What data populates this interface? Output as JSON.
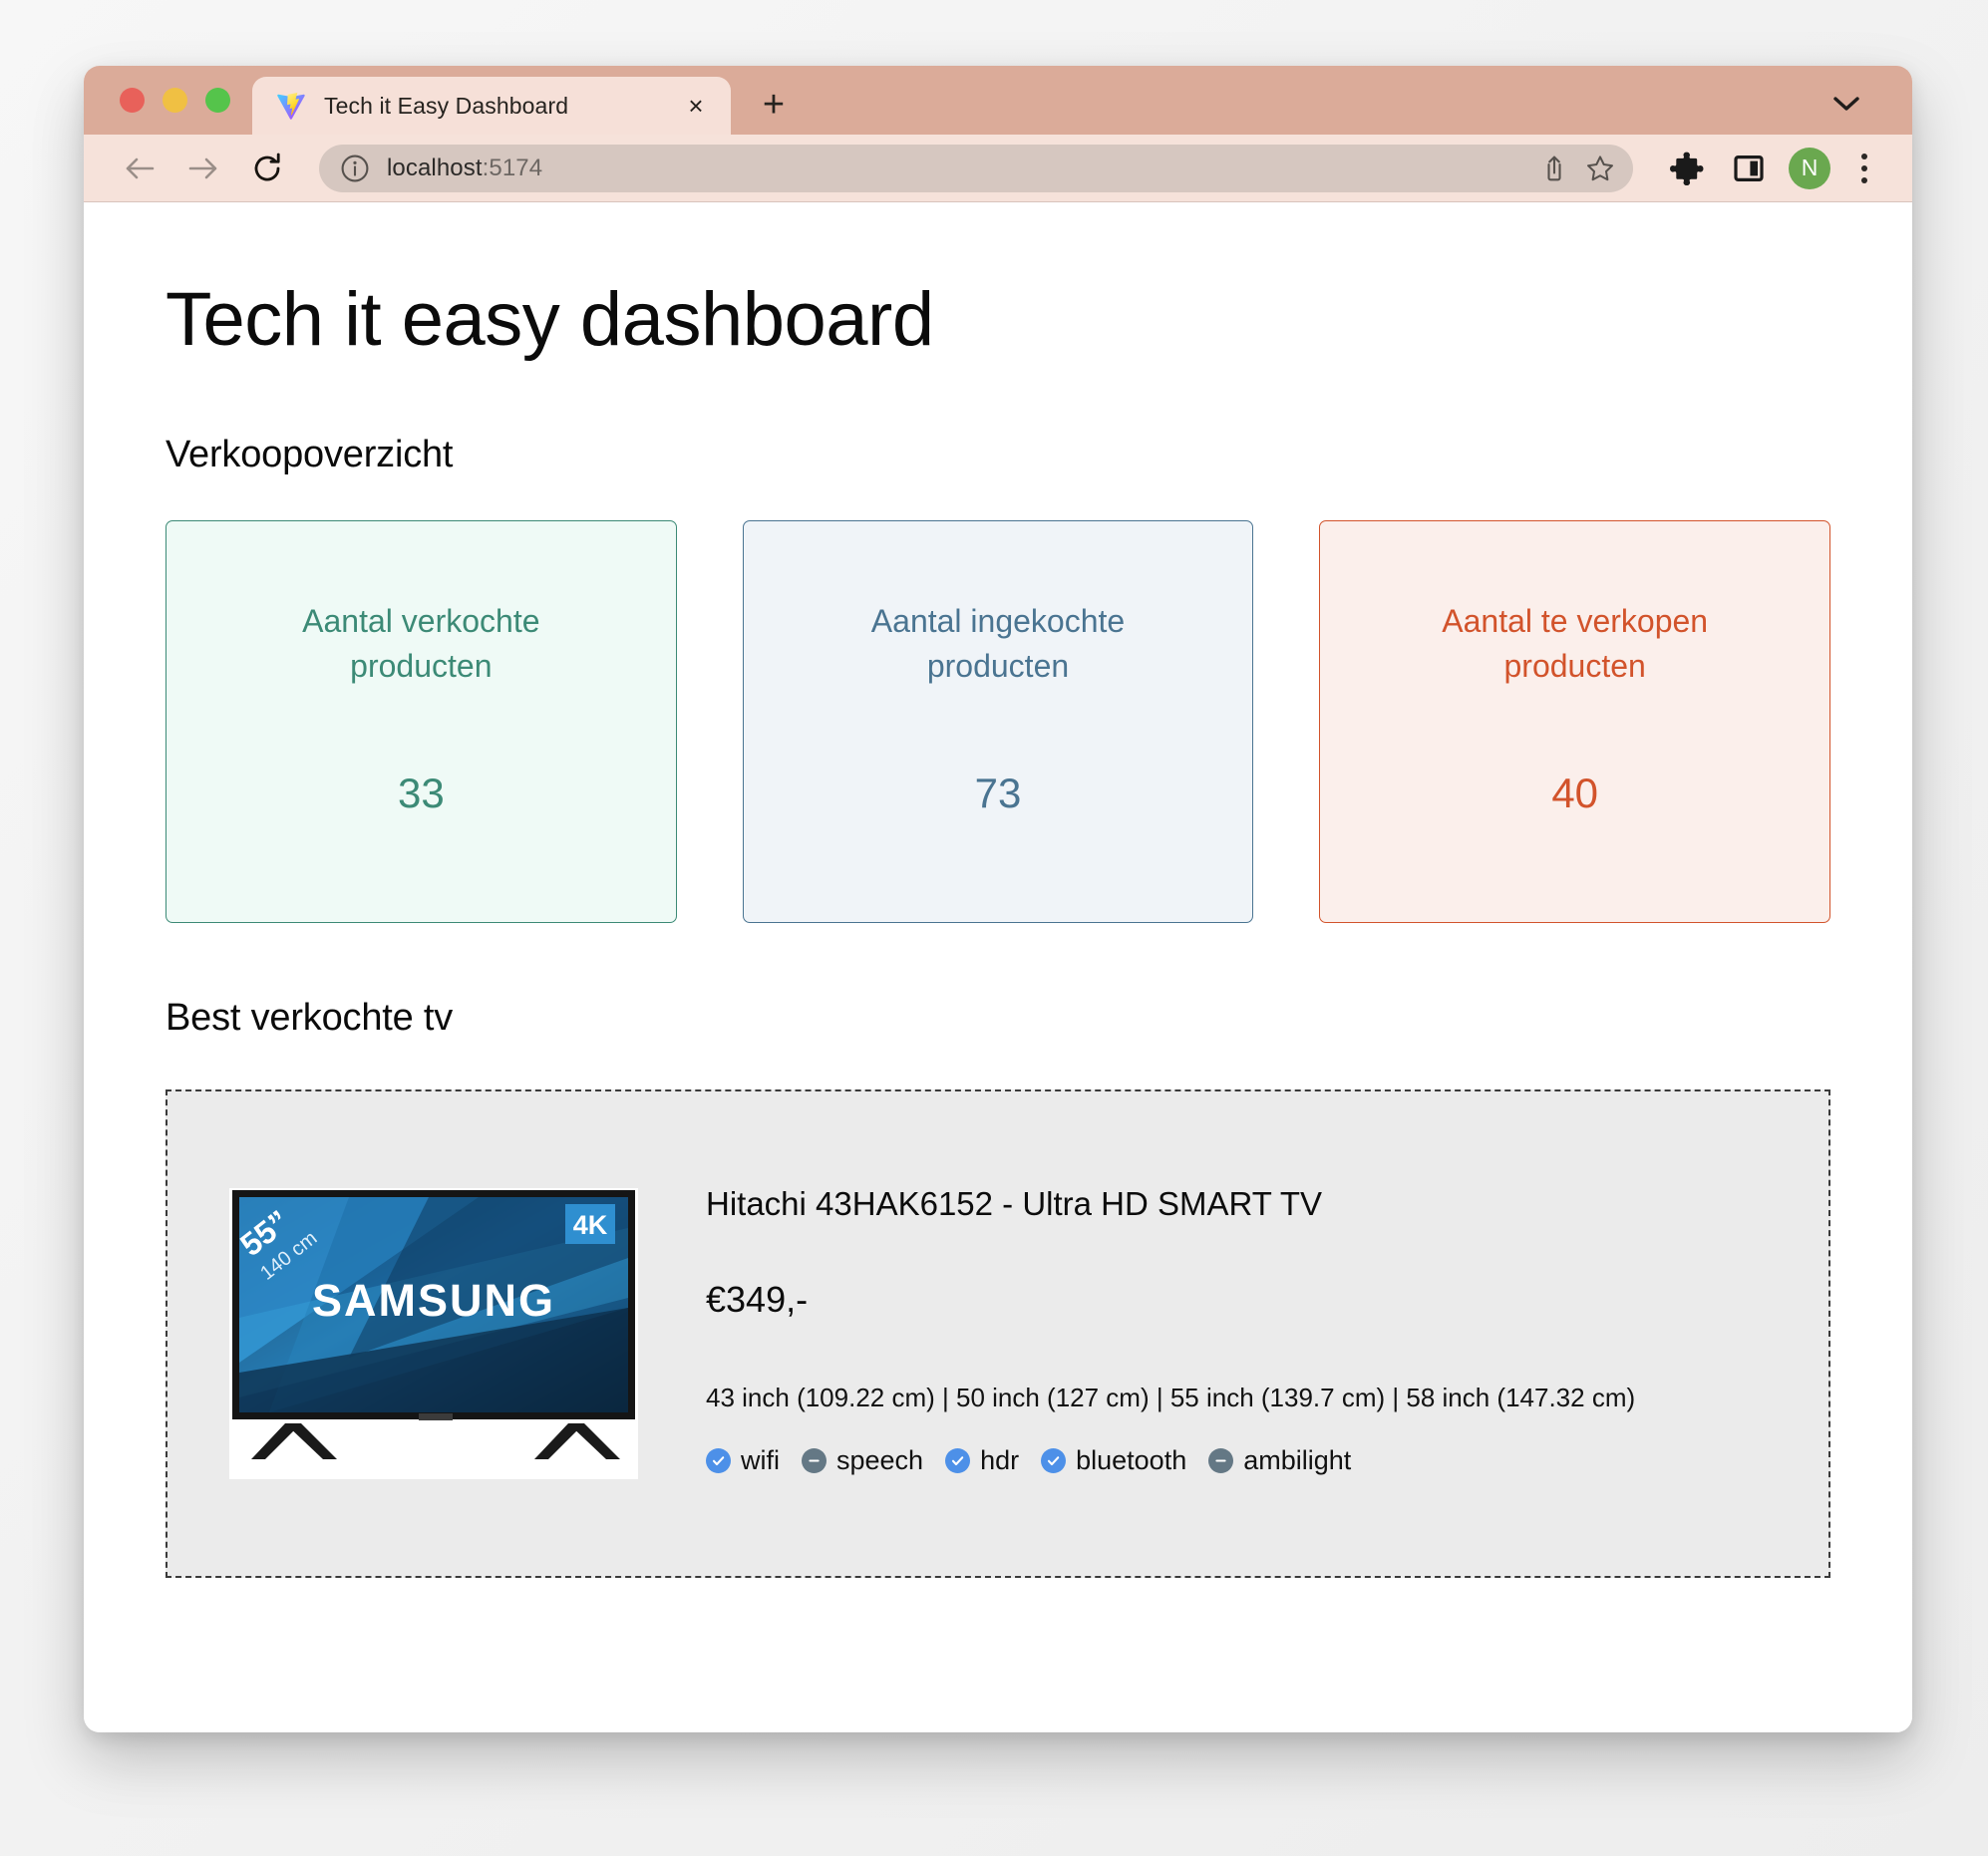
{
  "browser": {
    "tab": {
      "title": "Tech it Easy Dashboard",
      "favicon": "vite-logo-icon",
      "close_label": "×"
    },
    "new_tab_label": "+",
    "tab_search_icon": "chevron-down-icon",
    "toolbar": {
      "back_icon": "arrow-left-icon",
      "forward_icon": "arrow-right-icon",
      "reload_icon": "reload-icon",
      "site_info_icon": "info-circle-icon",
      "url_host": "localhost",
      "url_port": ":5174",
      "share_icon": "share-icon",
      "bookmark_icon": "star-icon",
      "extensions_icon": "puzzle-icon",
      "side_panel_icon": "side-panel-icon",
      "profile_initial": "N",
      "menu_icon": "kebab-menu-icon"
    },
    "window_controls": {
      "close": "close-window-button",
      "minimize": "minimize-window-button",
      "maximize": "maximize-window-button"
    }
  },
  "page": {
    "title": "Tech it easy dashboard",
    "sections": {
      "sales_overview": {
        "heading": "Verkoopoverzicht",
        "cards": [
          {
            "label": "Aantal verkochte producten",
            "value": "33",
            "tone": "green",
            "color": "#3c8a76",
            "bg": "#effaf6"
          },
          {
            "label": "Aantal ingekochte producten",
            "value": "73",
            "tone": "blue",
            "color": "#4a7491",
            "bg": "#f0f4f8"
          },
          {
            "label": "Aantal te verkopen producten",
            "value": "40",
            "tone": "orange",
            "color": "#d2532b",
            "bg": "#fbefeb"
          }
        ]
      },
      "best_selling_tv": {
        "heading": "Best verkochte tv",
        "product": {
          "image": {
            "brand": "SAMSUNG",
            "size_badge_inches": "55”",
            "size_badge_cm": "140 cm",
            "resolution_badge": "4K"
          },
          "name": "Hitachi 43HAK6152 - Ultra HD SMART TV",
          "price": "€349,-",
          "sizes": "43 inch (109.22 cm) | 50 inch (127 cm) | 55 inch (139.7 cm) | 58 inch (147.32 cm)",
          "features": [
            {
              "label": "wifi",
              "available": true
            },
            {
              "label": "speech",
              "available": false
            },
            {
              "label": "hdr",
              "available": true
            },
            {
              "label": "bluetooth",
              "available": true
            },
            {
              "label": "ambilight",
              "available": false
            }
          ]
        }
      }
    }
  }
}
